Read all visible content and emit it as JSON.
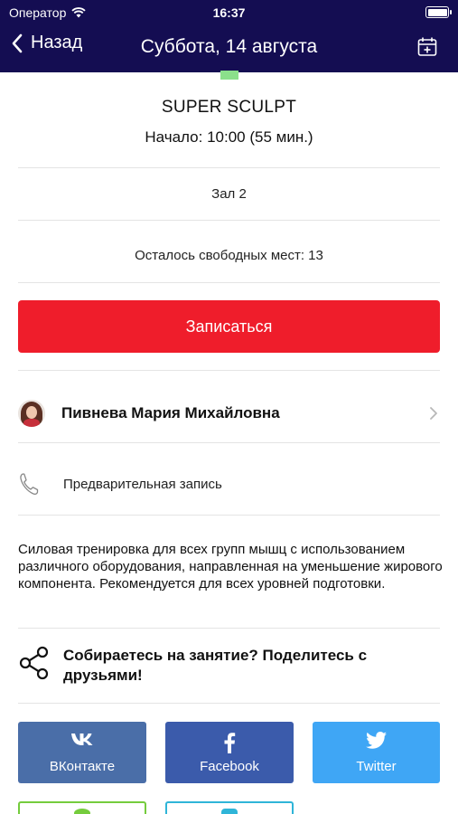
{
  "status_bar": {
    "carrier": "Оператор",
    "time": "16:37"
  },
  "nav": {
    "back_label": "Назад",
    "title": "Суббота, 14 августа"
  },
  "class_info": {
    "name": "SUPER SCULPT",
    "start": "Начало: 10:00 (55 мин.)",
    "hall": "Зал 2",
    "spots_left": "Осталось свободных мест: 13"
  },
  "signup_label": "Записаться",
  "trainer": {
    "name": "Пивнева Мария Михайловна"
  },
  "booking": {
    "label": "Предварительная запись"
  },
  "description": "Силовая тренировка для всех групп мышц с использованием различного оборудования, направленная на уменьшение жирового компонента. Рекомендуется для всех уровней подготовки.",
  "share": {
    "text": "Собираетесь на занятие? Поделитесь с друзьями!",
    "buttons": [
      {
        "label": "ВКонтакте",
        "icon": "vk-icon",
        "color": "#4a6ea8"
      },
      {
        "label": "Facebook",
        "icon": "facebook-icon",
        "color": "#3b5bab"
      },
      {
        "label": "Twitter",
        "icon": "twitter-icon",
        "color": "#3fa6f5"
      }
    ]
  },
  "colors": {
    "nav_bg": "#140d52",
    "accent_red": "#ef1d2b"
  }
}
